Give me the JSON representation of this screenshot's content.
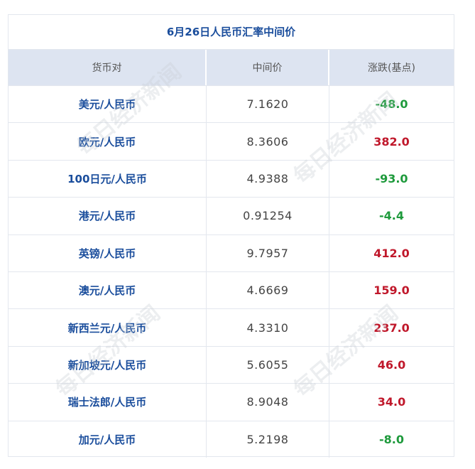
{
  "title": "6月26日人民币汇率中间价",
  "headers": {
    "pair": "货币对",
    "mid": "中间价",
    "change": "涨跌(基点)"
  },
  "rows": [
    {
      "pair": "美元/人民币",
      "mid": "7.1620",
      "change": "-48.0",
      "direction": "down"
    },
    {
      "pair": "欧元/人民币",
      "mid": "8.3606",
      "change": "382.0",
      "direction": "up"
    },
    {
      "pair": "100日元/人民币",
      "mid": "4.9388",
      "change": "-93.0",
      "direction": "down"
    },
    {
      "pair": "港元/人民币",
      "mid": "0.91254",
      "change": "-4.4",
      "direction": "down"
    },
    {
      "pair": "英镑/人民币",
      "mid": "9.7957",
      "change": "412.0",
      "direction": "up"
    },
    {
      "pair": "澳元/人民币",
      "mid": "4.6669",
      "change": "159.0",
      "direction": "up"
    },
    {
      "pair": "新西兰元/人民币",
      "mid": "4.3310",
      "change": "237.0",
      "direction": "up"
    },
    {
      "pair": "新加坡元/人民币",
      "mid": "5.6055",
      "change": "46.0",
      "direction": "up"
    },
    {
      "pair": "瑞士法郎/人民币",
      "mid": "8.9048",
      "change": "34.0",
      "direction": "up"
    },
    {
      "pair": "加元/人民币",
      "mid": "5.2198",
      "change": "-8.0",
      "direction": "down"
    }
  ],
  "colors": {
    "title": "#1a4d9c",
    "header_bg": "#dde4f1",
    "up": "#c0182b",
    "down": "#1e9a3c"
  },
  "watermark": "每日经济新闻"
}
